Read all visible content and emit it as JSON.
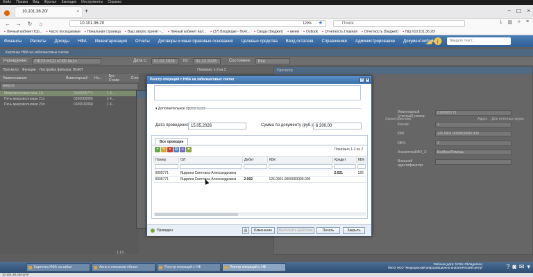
{
  "os_menu": [
    "Файл",
    "Правка",
    "Вид",
    "Журнал",
    "Закладки",
    "Инструменты",
    "Справка"
  ],
  "browser": {
    "tab_title": "10.101.36.20/",
    "url": "10.101.36.20",
    "zoom": "120%",
    "search_placeholder": "Поиск",
    "bookmarks": [
      "Личный кабинет Юр...",
      "Часто посещаемые",
      "Начальная страница",
      "Ваш запрос принят -...",
      "Личный кабинет нал...",
      "(37) Входящие - Почт...",
      "Своды (Бюджет)",
      "веник",
      "Outlook",
      "Отчетность Главная",
      "Отчетность (Бюджет)",
      "http://10.101.36.20/"
    ]
  },
  "app_menu": {
    "items": [
      "Финансы",
      "Расчеты",
      "Доходы",
      "НФА",
      "Инвентаризация",
      "Отчеты",
      "Договоры и иные правовые основания",
      "Целевые средства",
      "Ввод остатков",
      "Справочники",
      "Администрирование",
      "Документооборот"
    ],
    "search_placeholder": "Введите текст..."
  },
  "background": {
    "card_title": "Карточка НФА на забалансовых счетах",
    "filter": {
      "org_label": "Учреждение:",
      "org_value": "ПБУЗ НСО «ГКБ №1»",
      "date_label": "Дата с:",
      "date_from": "01.01.2026",
      "date_to_label": "по:",
      "date_to": "31.12.2026",
      "state_label": "Состояние:",
      "state_value": "Все"
    },
    "toolbar": [
      "Просмотр",
      "Функции",
      "Настройка фильтра: ВЫКЛ"
    ],
    "shown": "Показано 1-3 из 3",
    "viewer_title": "Просмотр",
    "grid_headers": [
      "Наименование",
      "Инвентарный",
      "Но...",
      "Бух Стоим",
      "Счет"
    ],
    "grid_search": "микров",
    "grid_rows": [
      {
        "name": "Микроволновая печь LG",
        "inv": "0100005771",
        "c": "1 3..."
      },
      {
        "name": "Печь микроволновая 21л",
        "inv": "0100000066",
        "c": "1 4..."
      },
      {
        "name": "Печь микроволновая 23л",
        "inv": "0100010068",
        "c": "1 4..."
      }
    ],
    "grid_bottom_text": "1 13...",
    "right_labels": [
      "Инвентарный (учетный) номер:",
      "Кол-во:",
      "КБК:",
      "КФО:",
      "АналитикаКФО_2:",
      "Внешний идентификатор:"
    ],
    "right_values": [
      "0100005771",
      "1",
      "126.0901.0000000000.000",
      "2",
      "БезВознПомощь",
      ""
    ],
    "right_tabs": [
      "Характеристики",
      "Адрес",
      "Для отчетных форм"
    ]
  },
  "modal": {
    "title": "Реестр операций с НФА на забалансовых счетах",
    "section_title": "Дополнительное примечание",
    "date_label": "Дата проведения:",
    "date_value": "15.05.2026",
    "sum_label": "Сумма по документу (руб.):",
    "sum_value": "6 200,00",
    "tab_label": "Все проводки",
    "shown": "Показано 1-2 из 2",
    "columns": [
      "Номер",
      "ОЛ",
      "Дебет",
      "КБК",
      "Кредит",
      "КБК"
    ],
    "rows": [
      {
        "num": "0005771",
        "person": "Яцкрина Светлана Александровна",
        "debit": "",
        "kbk": "",
        "credit": "2.021",
        "kbk2": "126"
      },
      {
        "num": "0005771",
        "person": "Яцкрина Светлана Александровна",
        "debit": "2.002",
        "kbk": "126.0901.0000000000.000",
        "credit": "",
        "kbk2": ""
      }
    ],
    "status": "Проведен",
    "btn_change": "Изменение",
    "btn_disabled": "Выполнить действие",
    "btn_print": "Печать",
    "btn_close": "Закрыть"
  },
  "taskbar": {
    "items": [
      "Карточка НФА на забал",
      "Акты о списании объект",
      "Реестр операций с НФ",
      "Реестр операций с НФ"
    ],
    "user_line1": "Рабочая дата: 12:55; Обладатель:",
    "user_line2": "ПБУЗ НСО \"Медицинский информационно-аналитический центр\""
  },
  "status_url": "10.101.36.20/com#"
}
